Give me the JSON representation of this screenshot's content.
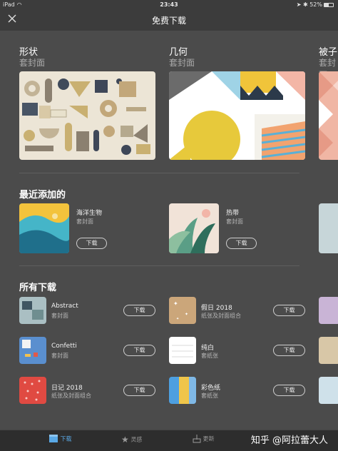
{
  "status": {
    "device": "iPad",
    "time": "23:43",
    "battery": "52%"
  },
  "nav": {
    "title": "免费下载"
  },
  "featured": [
    {
      "title": "形状",
      "subtitle": "套封面"
    },
    {
      "title": "几何",
      "subtitle": "套封面"
    },
    {
      "title": "被子",
      "subtitle": "套封面"
    }
  ],
  "recent": {
    "heading": "最近添加的",
    "items": [
      {
        "title": "海洋生物",
        "subtitle": "套封面",
        "button": "下载"
      },
      {
        "title": "热带",
        "subtitle": "套封面",
        "button": "下载"
      }
    ]
  },
  "all": {
    "heading": "所有下载",
    "items": [
      {
        "title": "Abstract",
        "subtitle": "套封面",
        "button": "下载"
      },
      {
        "title": "假日 2018",
        "subtitle": "纸张及封面组合",
        "button": "下载"
      },
      {
        "title": "Confetti",
        "subtitle": "套封面",
        "button": "下载"
      },
      {
        "title": "纯白",
        "subtitle": "套纸张",
        "button": "下载"
      },
      {
        "title": "日记 2018",
        "subtitle": "纸张及封面组合",
        "button": "下载"
      },
      {
        "title": "彩色纸",
        "subtitle": "套纸张",
        "button": "下载"
      }
    ]
  },
  "tabs": [
    {
      "label": "下载",
      "icon": "store-icon",
      "active": true
    },
    {
      "label": "灵感",
      "icon": "star-icon",
      "active": false
    },
    {
      "label": "更新",
      "icon": "download-tray-icon",
      "active": false
    }
  ],
  "watermark": "知乎 @阿拉蕾大人",
  "colors": {
    "background": "#4b4b4b",
    "accent": "#5aa9e6"
  }
}
